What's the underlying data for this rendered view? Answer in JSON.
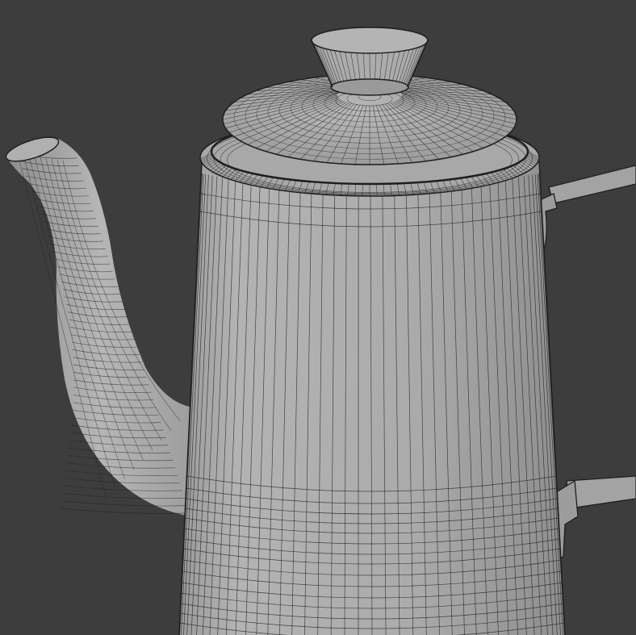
{
  "scene": {
    "background": "#3d3d3d",
    "surface": "#a9a9a9",
    "surface_light": "#b5b5b5",
    "surface_dark": "#8f8f8f",
    "wire": "#1e1e1e",
    "subject": "wireframe-teapot"
  }
}
